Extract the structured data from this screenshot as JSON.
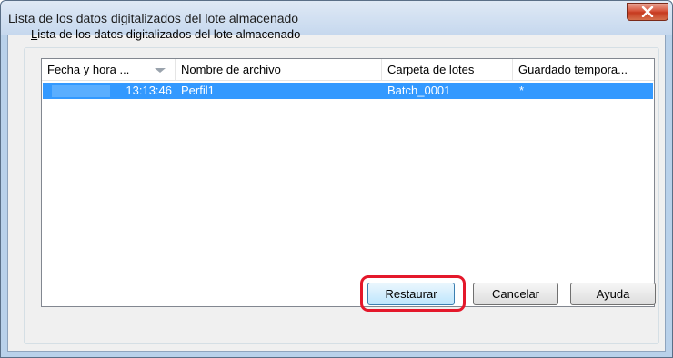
{
  "window": {
    "title": "Lista de los datos digitalizados del lote almacenado",
    "close_icon": "close-icon"
  },
  "group": {
    "label_accel": "L",
    "label_rest": "ista de los datos digitalizados del lote almacenado"
  },
  "list": {
    "columns": [
      "Fecha y hora ...",
      "Nombre de archivo",
      "Carpeta de lotes",
      "Guardado tempora..."
    ],
    "sort_icon": "sort-descending-icon",
    "rows": [
      {
        "time": "13:13:46",
        "name": "Perfil1",
        "folder": "Batch_0001",
        "saved": "*"
      }
    ]
  },
  "buttons": {
    "restore": "Restaurar",
    "cancel": "Cancelar",
    "help": "Ayuda"
  },
  "colors": {
    "selection": "#3399ff",
    "highlight_ring": "#e4182b",
    "close_button": "#c63a1f"
  }
}
